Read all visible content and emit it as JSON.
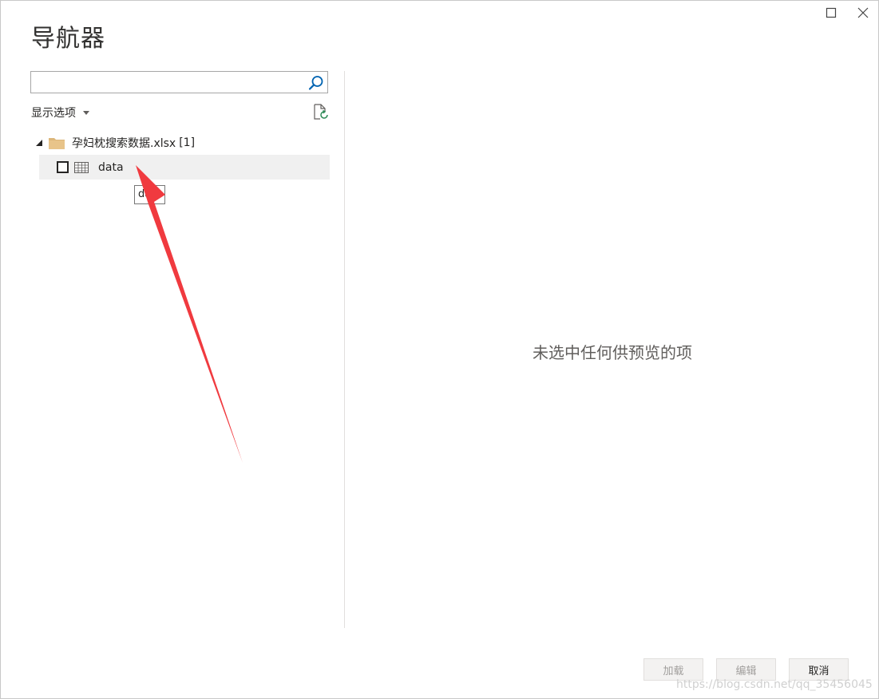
{
  "window": {
    "title": "导航器",
    "controls": {
      "maximize_icon": "maximize-icon",
      "close_icon": "close-icon"
    }
  },
  "search": {
    "value": "",
    "placeholder": "",
    "icon": "search-icon"
  },
  "display_options": {
    "label": "显示选项",
    "icon": "caret-down-icon"
  },
  "refresh": {
    "icon": "refresh-file-icon"
  },
  "tree": {
    "root": {
      "label": "孕妇枕搜索数据.xlsx",
      "count": "[1]",
      "expanded": true,
      "icon": "folder-icon"
    },
    "children": [
      {
        "label": "data",
        "checked": false,
        "icon": "table-icon",
        "tooltip": "data"
      }
    ]
  },
  "preview": {
    "empty_message": "未选中任何供预览的项"
  },
  "footer": {
    "load_label": "加载",
    "edit_label": "编辑",
    "cancel_label": "取消"
  },
  "watermark": "https://blog.csdn.net/qq_35456045",
  "colors": {
    "accent": "#0078d4",
    "annotation_arrow": "#f03a3f",
    "selected_row": "#f0f0f0"
  }
}
